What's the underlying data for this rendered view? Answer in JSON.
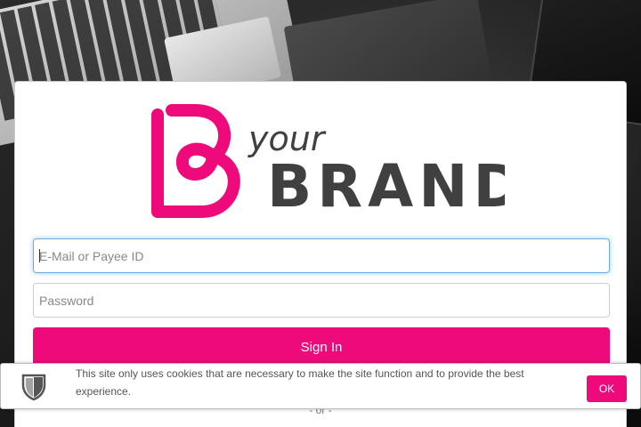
{
  "brand": {
    "logo_word_1": "your",
    "logo_word_2": "BRAND",
    "logo_letter": "B",
    "pink": "#ee0a7a",
    "dark": "#404040"
  },
  "login": {
    "email_placeholder": "E-Mail or Payee ID",
    "password_placeholder": "Password",
    "signin_label": "Sign In",
    "separator": "- or -"
  },
  "cookie_banner": {
    "icon": "shield-icon",
    "message": "This site only uses cookies that are necessary to make the site function and to provide the best experience.",
    "ok_label": "OK"
  }
}
